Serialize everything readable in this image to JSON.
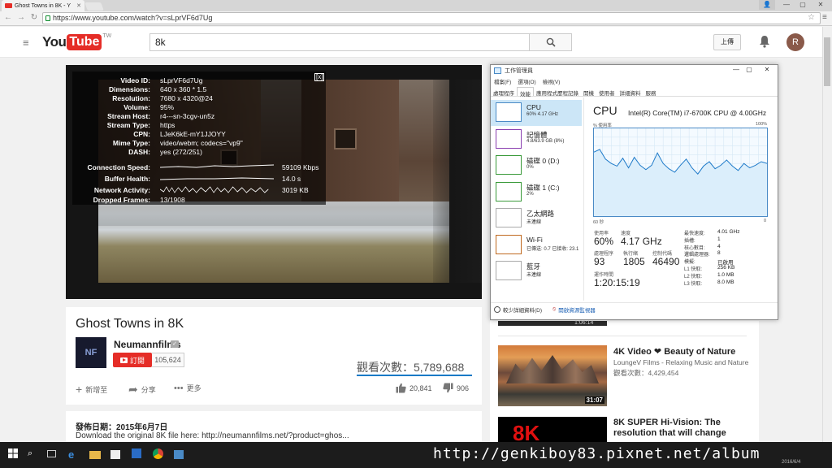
{
  "browser": {
    "tab_title": "Ghost Towns in 8K - Y",
    "url": "https://www.youtube.com/watch?v=sLprVF6d7Ug",
    "window_controls": [
      "—",
      "▢",
      "✕"
    ]
  },
  "youtube": {
    "logo_you": "You",
    "logo_tube": "Tube",
    "logo_region": "TW",
    "search_value": "8k",
    "upload_label": "上傳",
    "avatar_letter": "R"
  },
  "stats": {
    "rows": [
      {
        "label": "Video ID:",
        "value": "sLprVF6d7Ug"
      },
      {
        "label": "Dimensions:",
        "value": "640 x 360 * 1.5"
      },
      {
        "label": "Resolution:",
        "value": "7680 x 4320@24"
      },
      {
        "label": "Volume:",
        "value": "95%"
      },
      {
        "label": "Stream Host:",
        "value": "r4---sn-3cgv-un5z"
      },
      {
        "label": "Stream Type:",
        "value": "https"
      },
      {
        "label": "CPN:",
        "value": "LJeK6kE-mY1JJOYY"
      },
      {
        "label": "Mime Type:",
        "value": "video/webm; codecs=\"vp9\""
      },
      {
        "label": "DASH:",
        "value": "yes (272/251)"
      }
    ],
    "graph_rows": [
      {
        "label": "Connection Speed:",
        "value": "59109 Kbps"
      },
      {
        "label": "Buffer Health:",
        "value": "14.0 s"
      },
      {
        "label": "Network Activity:",
        "value": "3019 KB"
      }
    ],
    "dropped": {
      "label": "Dropped Frames:",
      "value": "13/1908"
    },
    "close": "[x]"
  },
  "video_info": {
    "title": "Ghost Towns in 8K",
    "channel": "Neumannfilms",
    "channel_logo": "NF",
    "subscribe": "訂閱",
    "subscribers": "105,624",
    "views": "觀看次數：5,789,688",
    "actions": [
      "新增至",
      "分享",
      "更多"
    ],
    "likes": "20,841",
    "dislikes": "906",
    "published": "發佈日期：2015年6月7日",
    "description": "Download the original 8K file here: http://neumannfilms.net/?product=ghos..."
  },
  "sidebar": {
    "top_duration": "1:06:14",
    "videos": [
      {
        "title": "4K Video ❤ Beauty of Nature",
        "channel": "LoungeV Films - Relaxing Music and Nature",
        "views": "觀看次數：4,429,454",
        "duration": "31:07"
      },
      {
        "title": "8K SUPER Hi-Vision: The resolution that will change",
        "thumb_text": "8K"
      }
    ]
  },
  "taskmgr": {
    "title": "工作管理員",
    "menu": [
      "檔案(F)",
      "選項(O)",
      "檢視(V)"
    ],
    "tabs": [
      "處理程序",
      "效能",
      "應用程式歷程記錄",
      "開機",
      "使用者",
      "詳細資料",
      "服務"
    ],
    "resources": [
      {
        "name": "CPU",
        "sub": "60% 4.17 GHz"
      },
      {
        "name": "記憶體",
        "sub": "4.8/63.9 GB (8%)"
      },
      {
        "name": "磁碟 0 (D:)",
        "sub": "0%"
      },
      {
        "name": "磁碟 1 (C:)",
        "sub": "2%"
      },
      {
        "name": "乙太網路",
        "sub": "未連線"
      },
      {
        "name": "Wi-Fi",
        "sub": "已傳送: 0.7 已接收: 23.1"
      },
      {
        "name": "藍牙",
        "sub": "未連線"
      }
    ],
    "heading": "CPU",
    "model": "Intel(R) Core(TM) i7-6700K CPU @ 4.00GHz",
    "pct_label": "% 使用率",
    "pct_max": "100%",
    "axis_left": "60 秒",
    "axis_right": "0",
    "stats": [
      {
        "label": "使用率",
        "value": "60%"
      },
      {
        "label": "速度",
        "value": "4.17 GHz"
      },
      {
        "label": "處理程序",
        "value": "93"
      },
      {
        "label": "執行緒",
        "value": "1805"
      },
      {
        "label": "控制代碼",
        "value": "46490"
      },
      {
        "label": "運作時間",
        "value": "1:20:15:19"
      }
    ],
    "specs": [
      {
        "k": "最快速度:",
        "v": "4.01 GHz"
      },
      {
        "k": "插槽:",
        "v": "1"
      },
      {
        "k": "核心數目:",
        "v": "4"
      },
      {
        "k": "邏輯處理器:",
        "v": "8"
      },
      {
        "k": "模擬:",
        "v": "已啟用"
      },
      {
        "k": "L1 快取:",
        "v": "256 KB"
      },
      {
        "k": "L2 快取:",
        "v": "1.0 MB"
      },
      {
        "k": "L3 快取:",
        "v": "8.0 MB"
      }
    ],
    "fewer_details": "較少詳細資料(D)",
    "resource_monitor": "開啟資源監視器"
  },
  "chart_data": {
    "type": "line",
    "x": [
      60,
      58,
      56,
      54,
      52,
      50,
      48,
      46,
      44,
      42,
      40,
      38,
      36,
      34,
      32,
      30,
      28,
      26,
      24,
      22,
      20,
      18,
      16,
      14,
      12,
      10,
      8,
      6,
      4,
      2,
      0
    ],
    "values": [
      73,
      76,
      65,
      60,
      57,
      66,
      55,
      67,
      58,
      53,
      58,
      72,
      60,
      54,
      50,
      58,
      65,
      55,
      48,
      57,
      62,
      54,
      58,
      64,
      57,
      52,
      60,
      55,
      58,
      62,
      60
    ],
    "ylim": [
      0,
      100
    ],
    "xlabel": "60 秒",
    "ylabel": "% 使用率"
  },
  "watermark": "http://genkiboy83.pixnet.net/album",
  "taskbar_date": "2016/6/4"
}
